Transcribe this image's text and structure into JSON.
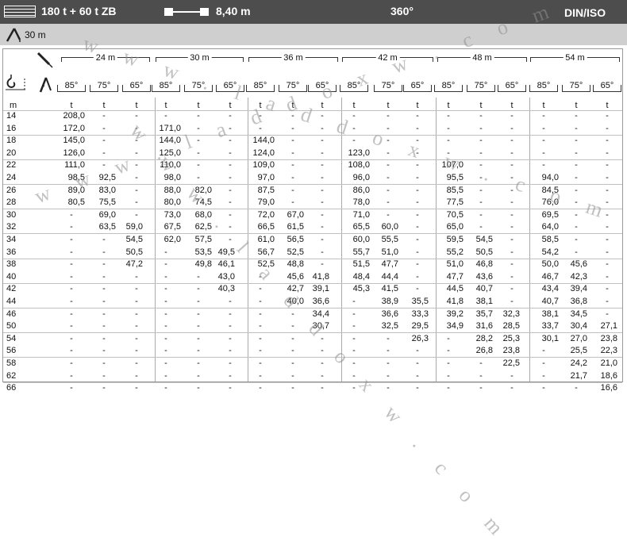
{
  "header": {
    "config": "180 t + 60 t ZB",
    "boom_length": "8,40 m",
    "slew": "360°",
    "standard": "DIN/ISO"
  },
  "subheader": {
    "jib_length": "30 m"
  },
  "icons": [
    "counterweight-grid-icon",
    "boom-length-icon",
    "luffing-jib-icon",
    "hook-radius-icon",
    "jib-angle-icon"
  ],
  "columns": {
    "lengths": [
      "24 m",
      "30 m",
      "36 m",
      "42 m",
      "48 m",
      "54 m"
    ],
    "angles": [
      "85°",
      "75°",
      "65°"
    ],
    "unit_radius": "m",
    "unit_load": "t"
  },
  "rows": [
    {
      "r": "14",
      "v": [
        "208,0",
        "-",
        "-",
        "-",
        "-",
        "-",
        "-",
        "-",
        "-",
        "-",
        "-",
        "-",
        "-",
        "-",
        "-",
        "-",
        "-",
        "-"
      ]
    },
    {
      "r": "16",
      "v": [
        "172,0",
        "-",
        "-",
        "171,0",
        "-",
        "-",
        "-",
        "-",
        "-",
        "-",
        "-",
        "-",
        "-",
        "-",
        "-",
        "-",
        "-",
        "-"
      ]
    },
    {
      "r": "18",
      "v": [
        "145,0",
        "-",
        "-",
        "144,0",
        "-",
        "-",
        "144,0",
        "-",
        "-",
        "-",
        "-",
        "-",
        "-",
        "-",
        "-",
        "-",
        "-",
        "-"
      ]
    },
    {
      "r": "20",
      "v": [
        "126,0",
        "-",
        "-",
        "125,0",
        "-",
        "-",
        "124,0",
        "-",
        "-",
        "123,0",
        "-",
        "-",
        "-",
        "-",
        "-",
        "-",
        "-",
        "-"
      ]
    },
    {
      "r": "22",
      "v": [
        "111,0",
        "-",
        "-",
        "110,0",
        "-",
        "-",
        "109,0",
        "-",
        "-",
        "108,0",
        "-",
        "-",
        "107,0",
        "-",
        "-",
        "-",
        "-",
        "-"
      ]
    },
    {
      "r": "24",
      "v": [
        "98,5",
        "92,5",
        "-",
        "98,0",
        "-",
        "-",
        "97,0",
        "-",
        "-",
        "96,0",
        "-",
        "-",
        "95,5",
        "-",
        "-",
        "94,0",
        "-",
        "-"
      ]
    },
    {
      "r": "26",
      "v": [
        "89,0",
        "83,0",
        "-",
        "88,0",
        "82,0",
        "-",
        "87,5",
        "-",
        "-",
        "86,0",
        "-",
        "-",
        "85,5",
        "-",
        "-",
        "84,5",
        "-",
        "-"
      ]
    },
    {
      "r": "28",
      "v": [
        "80,5",
        "75,5",
        "-",
        "80,0",
        "74,5",
        "-",
        "79,0",
        "-",
        "-",
        "78,0",
        "-",
        "-",
        "77,5",
        "-",
        "-",
        "76,0",
        "-",
        "-"
      ]
    },
    {
      "r": "30",
      "v": [
        "-",
        "69,0",
        "-",
        "73,0",
        "68,0",
        "-",
        "72,0",
        "67,0",
        "-",
        "71,0",
        "-",
        "-",
        "70,5",
        "-",
        "-",
        "69,5",
        "-",
        "-"
      ]
    },
    {
      "r": "32",
      "v": [
        "-",
        "63,5",
        "59,0",
        "67,5",
        "62,5",
        "-",
        "66,5",
        "61,5",
        "-",
        "65,5",
        "60,0",
        "-",
        "65,0",
        "-",
        "-",
        "64,0",
        "-",
        "-"
      ]
    },
    {
      "r": "34",
      "v": [
        "-",
        "-",
        "54,5",
        "62,0",
        "57,5",
        "-",
        "61,0",
        "56,5",
        "-",
        "60,0",
        "55,5",
        "-",
        "59,5",
        "54,5",
        "-",
        "58,5",
        "-",
        "-"
      ]
    },
    {
      "r": "36",
      "v": [
        "-",
        "-",
        "50,5",
        "-",
        "53,5",
        "49,5",
        "56,7",
        "52,5",
        "-",
        "55,7",
        "51,0",
        "-",
        "55,2",
        "50,5",
        "-",
        "54,2",
        "-",
        "-"
      ]
    },
    {
      "r": "38",
      "v": [
        "-",
        "-",
        "47,2",
        "-",
        "49,8",
        "46,1",
        "52,5",
        "48,8",
        "-",
        "51,5",
        "47,7",
        "-",
        "51,0",
        "46,8",
        "-",
        "50,0",
        "45,6",
        "-"
      ]
    },
    {
      "r": "40",
      "v": [
        "-",
        "-",
        "-",
        "-",
        "-",
        "43,0",
        "-",
        "45,6",
        "41,8",
        "48,4",
        "44,4",
        "-",
        "47,7",
        "43,6",
        "-",
        "46,7",
        "42,3",
        "-"
      ]
    },
    {
      "r": "42",
      "v": [
        "-",
        "-",
        "-",
        "-",
        "-",
        "40,3",
        "-",
        "42,7",
        "39,1",
        "45,3",
        "41,5",
        "-",
        "44,5",
        "40,7",
        "-",
        "43,4",
        "39,4",
        "-"
      ]
    },
    {
      "r": "44",
      "v": [
        "-",
        "-",
        "-",
        "-",
        "-",
        "-",
        "-",
        "40,0",
        "36,6",
        "-",
        "38,9",
        "35,5",
        "41,8",
        "38,1",
        "-",
        "40,7",
        "36,8",
        "-"
      ]
    },
    {
      "r": "46",
      "v": [
        "-",
        "-",
        "-",
        "-",
        "-",
        "-",
        "-",
        "-",
        "34,4",
        "-",
        "36,6",
        "33,3",
        "39,2",
        "35,7",
        "32,3",
        "38,1",
        "34,5",
        "-"
      ]
    },
    {
      "r": "50",
      "v": [
        "-",
        "-",
        "-",
        "-",
        "-",
        "-",
        "-",
        "-",
        "30,7",
        "-",
        "32,5",
        "29,5",
        "34,9",
        "31,6",
        "28,5",
        "33,7",
        "30,4",
        "27,1"
      ]
    },
    {
      "r": "54",
      "v": [
        "-",
        "-",
        "-",
        "-",
        "-",
        "-",
        "-",
        "-",
        "-",
        "-",
        "-",
        "26,3",
        "-",
        "28,2",
        "25,3",
        "30,1",
        "27,0",
        "23,8"
      ]
    },
    {
      "r": "56",
      "v": [
        "-",
        "-",
        "-",
        "-",
        "-",
        "-",
        "-",
        "-",
        "-",
        "-",
        "-",
        "-",
        "-",
        "26,8",
        "23,8",
        "-",
        "25,5",
        "22,3"
      ]
    },
    {
      "r": "58",
      "v": [
        "-",
        "-",
        "-",
        "-",
        "-",
        "-",
        "-",
        "-",
        "-",
        "-",
        "-",
        "-",
        "-",
        "-",
        "22,5",
        "-",
        "24,2",
        "21,0"
      ]
    },
    {
      "r": "62",
      "v": [
        "-",
        "-",
        "-",
        "-",
        "-",
        "-",
        "-",
        "-",
        "-",
        "-",
        "-",
        "-",
        "-",
        "-",
        "-",
        "-",
        "21,7",
        "18,6"
      ]
    },
    {
      "r": "66",
      "v": [
        "-",
        "-",
        "-",
        "-",
        "-",
        "-",
        "-",
        "-",
        "-",
        "-",
        "-",
        "-",
        "-",
        "-",
        "-",
        "-",
        "-",
        "16,6"
      ]
    }
  ],
  "watermarks": [
    "w w w . l a d d o x w . c o m",
    "w w w . l a d d o x w . c o m",
    "w w w . l a d d o x w . c o m"
  ]
}
